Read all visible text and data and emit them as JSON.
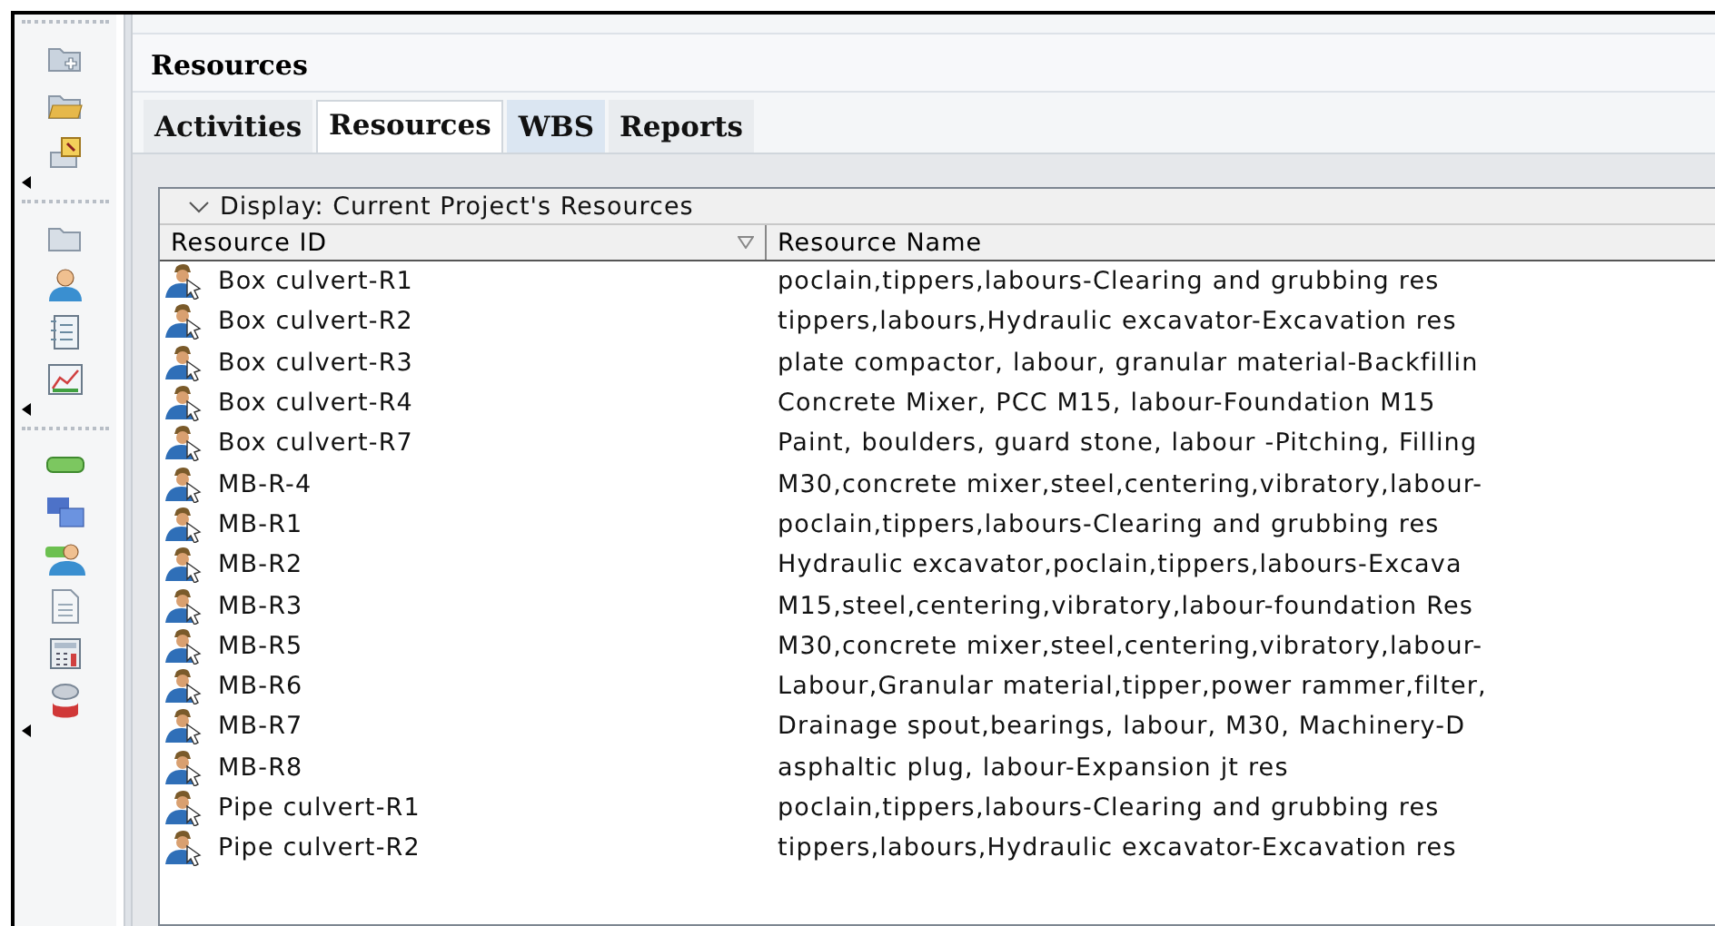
{
  "panel": {
    "title": "Resources"
  },
  "tabs": [
    {
      "label": "Activities",
      "selected": false
    },
    {
      "label": "Resources",
      "selected": true
    },
    {
      "label": "WBS",
      "selected": false
    },
    {
      "label": "Reports",
      "selected": false
    }
  ],
  "display": {
    "label": "Display: Current Project's Resources",
    "expanded": true
  },
  "table": {
    "columns": [
      {
        "label": "Resource ID"
      },
      {
        "label": "Resource Name"
      }
    ],
    "rows": [
      {
        "id": "Box culvert-R1",
        "name": "poclain,tippers,labours-Clearing and grubbing res"
      },
      {
        "id": "Box culvert-R2",
        "name": "tippers,labours,Hydraulic excavator-Excavation res"
      },
      {
        "id": "Box culvert-R3",
        "name": "plate compactor, labour, granular material-Backfillin"
      },
      {
        "id": "Box culvert-R4",
        "name": "Concrete Mixer, PCC M15, labour-Foundation M15"
      },
      {
        "id": "Box culvert-R7",
        "name": "Paint, boulders, guard stone, labour -Pitching, Filling"
      },
      {
        "id": "MB-R-4",
        "name": "M30,concrete mixer,steel,centering,vibratory,labour-"
      },
      {
        "id": "MB-R1",
        "name": "poclain,tippers,labours-Clearing and grubbing res"
      },
      {
        "id": "MB-R2",
        "name": "Hydraulic excavator,poclain,tippers,labours-Excava"
      },
      {
        "id": "MB-R3",
        "name": "M15,steel,centering,vibratory,labour-foundation Res"
      },
      {
        "id": "MB-R5",
        "name": "M30,concrete mixer,steel,centering,vibratory,labour-"
      },
      {
        "id": "MB-R6",
        "name": "Labour,Granular material,tipper,power rammer,filter,"
      },
      {
        "id": "MB-R7",
        "name": "Drainage spout,bearings, labour, M30, Machinery-D"
      },
      {
        "id": "MB-R8",
        "name": "asphaltic plug, labour-Expansion jt res"
      },
      {
        "id": "Pipe culvert-R1",
        "name": "poclain,tippers,labours-Clearing and grubbing res"
      },
      {
        "id": "Pipe culvert-R2",
        "name": "tippers,labours,Hydraulic excavator-Excavation res"
      }
    ]
  }
}
